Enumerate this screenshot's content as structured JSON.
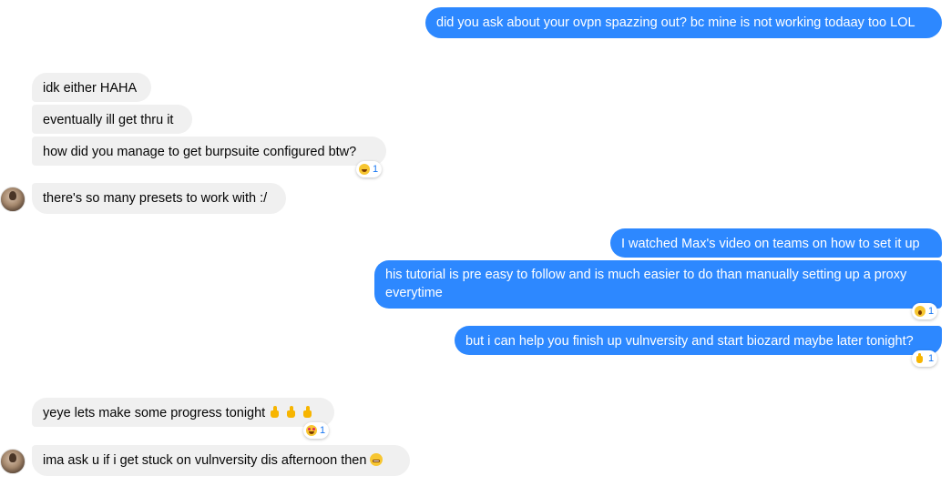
{
  "colors": {
    "outgoing_bubble": "#2d88ff",
    "incoming_bubble": "#f0f0f0",
    "reaction_count": "#1877f2"
  },
  "messages": [
    {
      "text": "did you ask about your ovpn spazzing out? bc mine is not working todaay too LOL",
      "direction": "outgoing"
    },
    {
      "text": "idk either HAHA",
      "direction": "incoming"
    },
    {
      "text": "eventually ill get thru it",
      "direction": "incoming"
    },
    {
      "text": "how did you manage to get burpsuite configured btw?",
      "direction": "incoming",
      "reaction": {
        "icon": "laughing-emoji-icon",
        "count": "1"
      }
    },
    {
      "text": "there's so many presets to work with :/",
      "direction": "incoming"
    },
    {
      "text": "I watched Max's video on teams on how to set it up",
      "direction": "outgoing"
    },
    {
      "text": "his tutorial is pre easy to follow and is much easier to do than manually setting up a proxy everytime",
      "direction": "outgoing",
      "reaction": {
        "icon": "wow-emoji-icon",
        "count": "1"
      }
    },
    {
      "text": "but i can help you finish up vulnversity and start biozard maybe later tonight?",
      "direction": "outgoing",
      "reaction": {
        "icon": "thumbs-up-emoji-icon",
        "count": "1"
      }
    },
    {
      "text": "yeye lets make some progress tonight",
      "direction": "incoming",
      "inline_emoji": [
        "thumbs-up-icon",
        "thumbs-up-icon",
        "thumbs-up-icon"
      ],
      "reaction": {
        "icon": "heart-eyes-emoji-icon",
        "count": "1"
      }
    },
    {
      "text": "ima ask u if i get stuck on vulnversity dis afternoon then",
      "direction": "incoming",
      "inline_emoji": [
        "grimacing-face-icon"
      ]
    }
  ],
  "avatars": [
    "contact-avatar",
    "contact-avatar"
  ]
}
